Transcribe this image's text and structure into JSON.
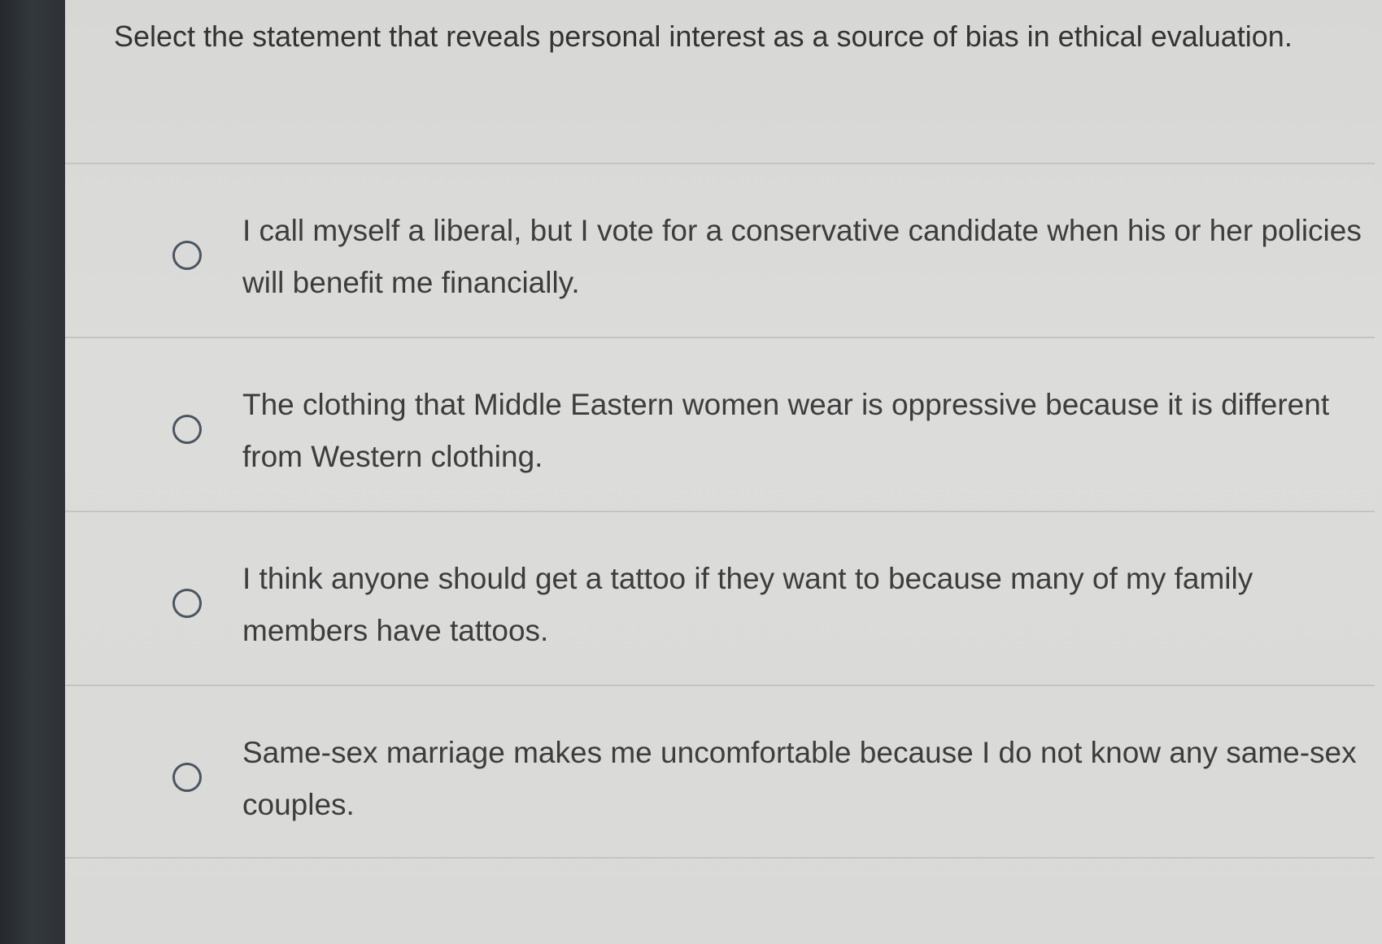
{
  "question": {
    "text": "Select the statement that reveals personal interest as a source of bias in ethical evaluation."
  },
  "options": [
    {
      "label": "I call myself a liberal, but I vote for a conservative candidate when his or her policies will benefit me financially.",
      "selected": false
    },
    {
      "label": "The clothing that Middle Eastern women wear is oppressive because it is different from Western clothing.",
      "selected": false
    },
    {
      "label": "I think anyone should get a tattoo if they want to because many of my family members have tattoos.",
      "selected": false
    },
    {
      "label": "Same-sex marriage makes me uncomfortable because I do not know any same-sex couples.",
      "selected": false
    }
  ]
}
